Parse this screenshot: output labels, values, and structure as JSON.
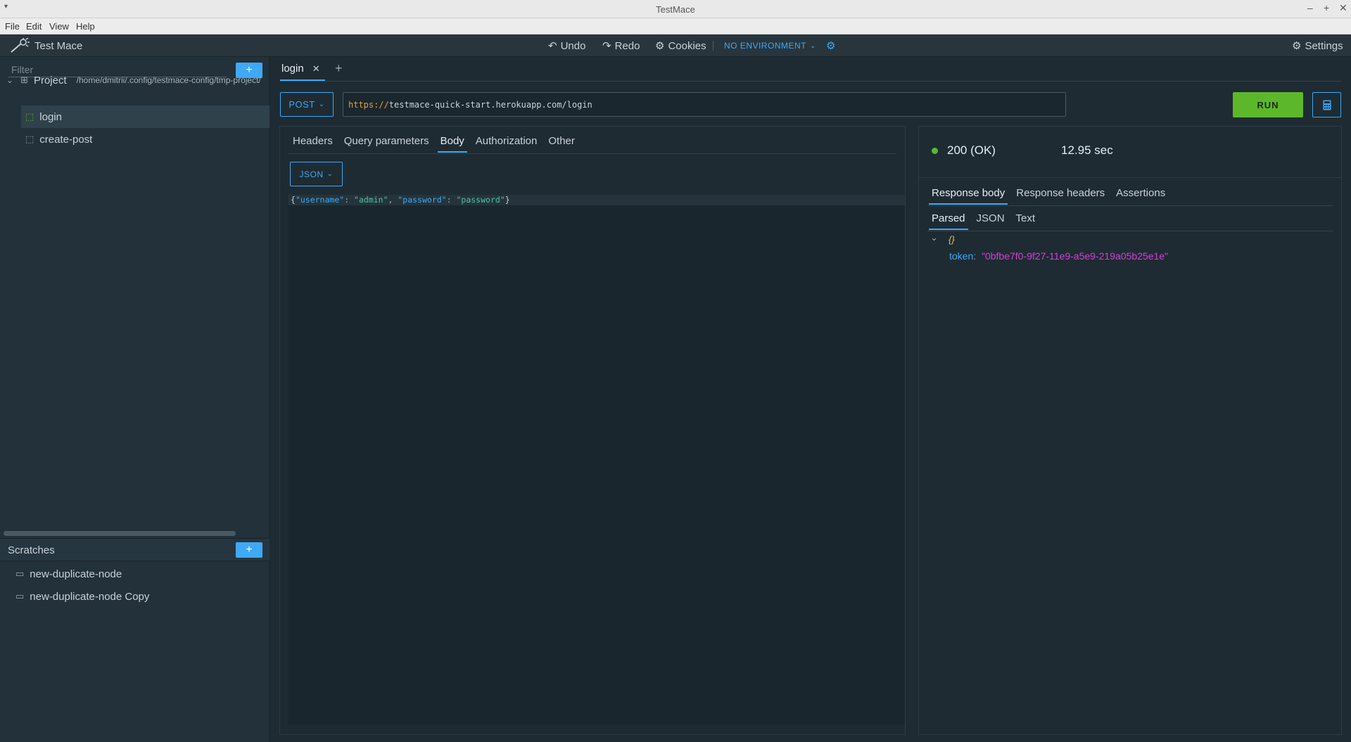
{
  "window": {
    "title": "TestMace"
  },
  "menubar": {
    "items": [
      "File",
      "Edit",
      "View",
      "Help"
    ]
  },
  "toolbar": {
    "app_name": "Test Mace",
    "undo": "Undo",
    "redo": "Redo",
    "cookies": "Cookies",
    "environment": "NO ENVIRONMENT",
    "settings": "Settings"
  },
  "sidebar": {
    "filter_placeholder": "Filter",
    "add_label": "+",
    "project": {
      "label": "Project",
      "path": "/home/dmitrii/.config/testmace-config/tmp-project/"
    },
    "items": [
      {
        "label": "login",
        "selected": true
      },
      {
        "label": "create-post",
        "selected": false
      }
    ],
    "scratches": {
      "label": "Scratches",
      "add_label": "+",
      "items": [
        {
          "label": "new-duplicate-node"
        },
        {
          "label": "new-duplicate-node Copy"
        }
      ]
    }
  },
  "tabs": [
    {
      "label": "login",
      "active": true
    }
  ],
  "add_tab_label": "+",
  "request": {
    "method": "POST",
    "url_scheme": "https://",
    "url_rest": "testmace-quick-start.herokuapp.com/login",
    "run_label": "RUN",
    "tabs": [
      "Headers",
      "Query parameters",
      "Body",
      "Authorization",
      "Other"
    ],
    "active_tab": "Body",
    "body_type": "JSON",
    "body": {
      "open": "{",
      "key1": "\"username\"",
      "val1": "\"admin\"",
      "key2": "\"password\"",
      "val2": "\"password\"",
      "close": "}"
    }
  },
  "response": {
    "status": "200 (OK)",
    "time": "12.95 sec",
    "tabs": [
      "Response body",
      "Response headers",
      "Assertions"
    ],
    "active_tab": "Response body",
    "format_tabs": [
      "Parsed",
      "JSON",
      "Text"
    ],
    "active_format": "Parsed",
    "parsed": {
      "root": "{}",
      "key": "token:",
      "value": "\"0bfbe7f0-9f27-11e9-a5e9-219a05b25e1e\""
    }
  },
  "colors": {
    "accent": "#3fa9f5",
    "run": "#5cb82a",
    "status_ok": "#5cb82a",
    "token_value": "#d63fd6"
  }
}
